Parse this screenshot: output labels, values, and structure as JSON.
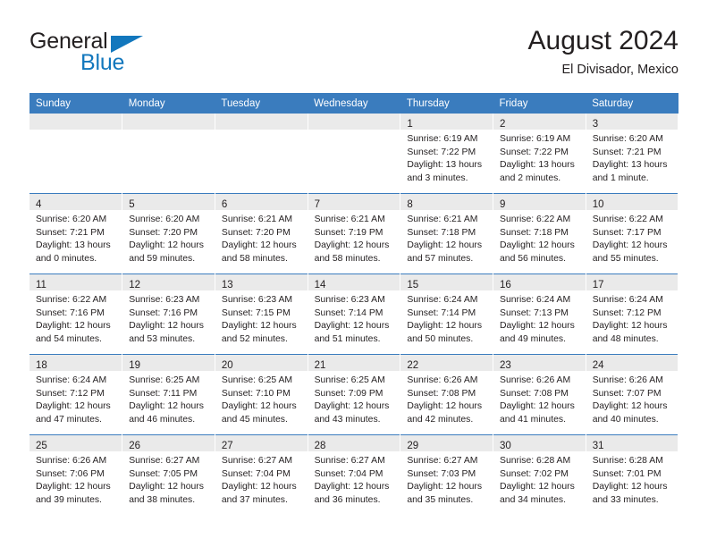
{
  "brand": {
    "name_part1": "General",
    "name_part2": "Blue",
    "accent_color": "#1277bd"
  },
  "header": {
    "title": "August 2024",
    "subtitle": "El Divisador, Mexico"
  },
  "theme": {
    "header_row_bg": "#3a7cbe",
    "daynum_band_bg": "#eaeaea",
    "grid_line": "#3a7cbe",
    "text": "#231f20"
  },
  "weekday_headers": [
    "Sunday",
    "Monday",
    "Tuesday",
    "Wednesday",
    "Thursday",
    "Friday",
    "Saturday"
  ],
  "weeks": [
    [
      {
        "day": "",
        "lines": []
      },
      {
        "day": "",
        "lines": []
      },
      {
        "day": "",
        "lines": []
      },
      {
        "day": "",
        "lines": []
      },
      {
        "day": "1",
        "lines": [
          "Sunrise: 6:19 AM",
          "Sunset: 7:22 PM",
          "Daylight: 13 hours",
          "and 3 minutes."
        ]
      },
      {
        "day": "2",
        "lines": [
          "Sunrise: 6:19 AM",
          "Sunset: 7:22 PM",
          "Daylight: 13 hours",
          "and 2 minutes."
        ]
      },
      {
        "day": "3",
        "lines": [
          "Sunrise: 6:20 AM",
          "Sunset: 7:21 PM",
          "Daylight: 13 hours",
          "and 1 minute."
        ]
      }
    ],
    [
      {
        "day": "4",
        "lines": [
          "Sunrise: 6:20 AM",
          "Sunset: 7:21 PM",
          "Daylight: 13 hours",
          "and 0 minutes."
        ]
      },
      {
        "day": "5",
        "lines": [
          "Sunrise: 6:20 AM",
          "Sunset: 7:20 PM",
          "Daylight: 12 hours",
          "and 59 minutes."
        ]
      },
      {
        "day": "6",
        "lines": [
          "Sunrise: 6:21 AM",
          "Sunset: 7:20 PM",
          "Daylight: 12 hours",
          "and 58 minutes."
        ]
      },
      {
        "day": "7",
        "lines": [
          "Sunrise: 6:21 AM",
          "Sunset: 7:19 PM",
          "Daylight: 12 hours",
          "and 58 minutes."
        ]
      },
      {
        "day": "8",
        "lines": [
          "Sunrise: 6:21 AM",
          "Sunset: 7:18 PM",
          "Daylight: 12 hours",
          "and 57 minutes."
        ]
      },
      {
        "day": "9",
        "lines": [
          "Sunrise: 6:22 AM",
          "Sunset: 7:18 PM",
          "Daylight: 12 hours",
          "and 56 minutes."
        ]
      },
      {
        "day": "10",
        "lines": [
          "Sunrise: 6:22 AM",
          "Sunset: 7:17 PM",
          "Daylight: 12 hours",
          "and 55 minutes."
        ]
      }
    ],
    [
      {
        "day": "11",
        "lines": [
          "Sunrise: 6:22 AM",
          "Sunset: 7:16 PM",
          "Daylight: 12 hours",
          "and 54 minutes."
        ]
      },
      {
        "day": "12",
        "lines": [
          "Sunrise: 6:23 AM",
          "Sunset: 7:16 PM",
          "Daylight: 12 hours",
          "and 53 minutes."
        ]
      },
      {
        "day": "13",
        "lines": [
          "Sunrise: 6:23 AM",
          "Sunset: 7:15 PM",
          "Daylight: 12 hours",
          "and 52 minutes."
        ]
      },
      {
        "day": "14",
        "lines": [
          "Sunrise: 6:23 AM",
          "Sunset: 7:14 PM",
          "Daylight: 12 hours",
          "and 51 minutes."
        ]
      },
      {
        "day": "15",
        "lines": [
          "Sunrise: 6:24 AM",
          "Sunset: 7:14 PM",
          "Daylight: 12 hours",
          "and 50 minutes."
        ]
      },
      {
        "day": "16",
        "lines": [
          "Sunrise: 6:24 AM",
          "Sunset: 7:13 PM",
          "Daylight: 12 hours",
          "and 49 minutes."
        ]
      },
      {
        "day": "17",
        "lines": [
          "Sunrise: 6:24 AM",
          "Sunset: 7:12 PM",
          "Daylight: 12 hours",
          "and 48 minutes."
        ]
      }
    ],
    [
      {
        "day": "18",
        "lines": [
          "Sunrise: 6:24 AM",
          "Sunset: 7:12 PM",
          "Daylight: 12 hours",
          "and 47 minutes."
        ]
      },
      {
        "day": "19",
        "lines": [
          "Sunrise: 6:25 AM",
          "Sunset: 7:11 PM",
          "Daylight: 12 hours",
          "and 46 minutes."
        ]
      },
      {
        "day": "20",
        "lines": [
          "Sunrise: 6:25 AM",
          "Sunset: 7:10 PM",
          "Daylight: 12 hours",
          "and 45 minutes."
        ]
      },
      {
        "day": "21",
        "lines": [
          "Sunrise: 6:25 AM",
          "Sunset: 7:09 PM",
          "Daylight: 12 hours",
          "and 43 minutes."
        ]
      },
      {
        "day": "22",
        "lines": [
          "Sunrise: 6:26 AM",
          "Sunset: 7:08 PM",
          "Daylight: 12 hours",
          "and 42 minutes."
        ]
      },
      {
        "day": "23",
        "lines": [
          "Sunrise: 6:26 AM",
          "Sunset: 7:08 PM",
          "Daylight: 12 hours",
          "and 41 minutes."
        ]
      },
      {
        "day": "24",
        "lines": [
          "Sunrise: 6:26 AM",
          "Sunset: 7:07 PM",
          "Daylight: 12 hours",
          "and 40 minutes."
        ]
      }
    ],
    [
      {
        "day": "25",
        "lines": [
          "Sunrise: 6:26 AM",
          "Sunset: 7:06 PM",
          "Daylight: 12 hours",
          "and 39 minutes."
        ]
      },
      {
        "day": "26",
        "lines": [
          "Sunrise: 6:27 AM",
          "Sunset: 7:05 PM",
          "Daylight: 12 hours",
          "and 38 minutes."
        ]
      },
      {
        "day": "27",
        "lines": [
          "Sunrise: 6:27 AM",
          "Sunset: 7:04 PM",
          "Daylight: 12 hours",
          "and 37 minutes."
        ]
      },
      {
        "day": "28",
        "lines": [
          "Sunrise: 6:27 AM",
          "Sunset: 7:04 PM",
          "Daylight: 12 hours",
          "and 36 minutes."
        ]
      },
      {
        "day": "29",
        "lines": [
          "Sunrise: 6:27 AM",
          "Sunset: 7:03 PM",
          "Daylight: 12 hours",
          "and 35 minutes."
        ]
      },
      {
        "day": "30",
        "lines": [
          "Sunrise: 6:28 AM",
          "Sunset: 7:02 PM",
          "Daylight: 12 hours",
          "and 34 minutes."
        ]
      },
      {
        "day": "31",
        "lines": [
          "Sunrise: 6:28 AM",
          "Sunset: 7:01 PM",
          "Daylight: 12 hours",
          "and 33 minutes."
        ]
      }
    ]
  ]
}
